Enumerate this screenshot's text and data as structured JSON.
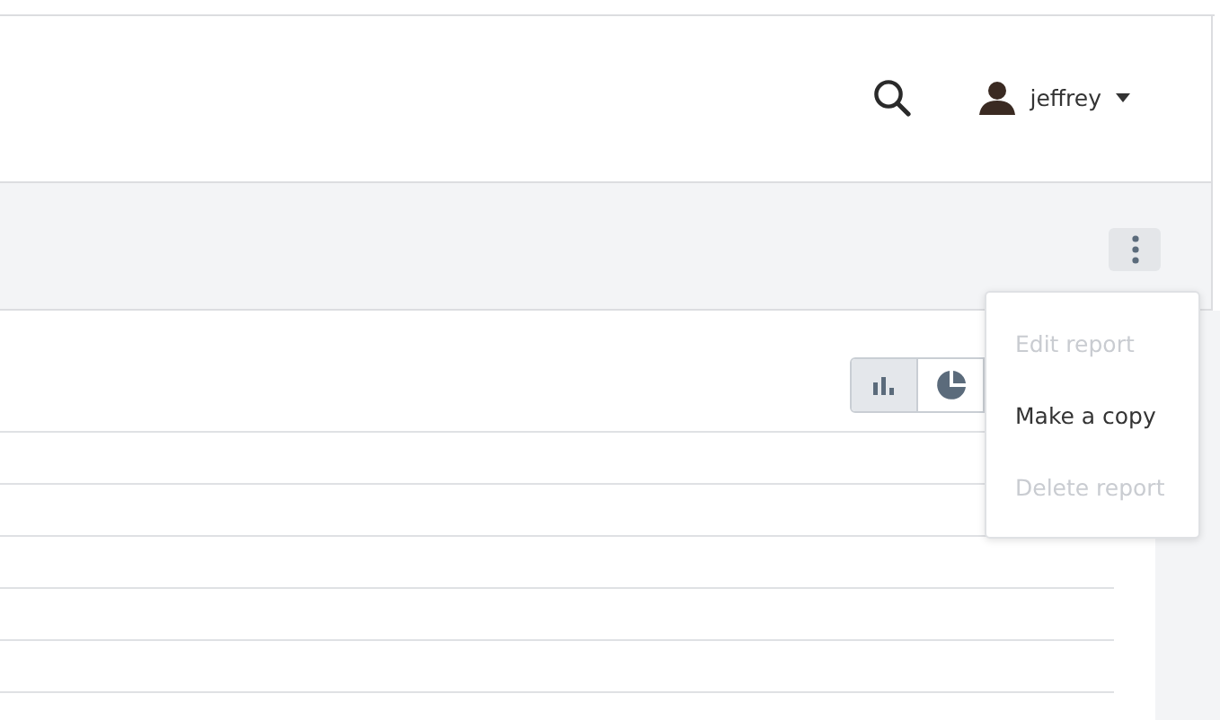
{
  "user_menu": {
    "name": "jeffrey"
  },
  "chart_toggle": [
    {
      "kind": "bar",
      "selected": true
    },
    {
      "kind": "pie",
      "selected": false
    }
  ],
  "actions_menu": {
    "items": [
      {
        "label": "Edit report",
        "disabled": true
      },
      {
        "label": "Make a copy",
        "disabled": false
      },
      {
        "label": "Delete report",
        "disabled": true
      }
    ]
  }
}
